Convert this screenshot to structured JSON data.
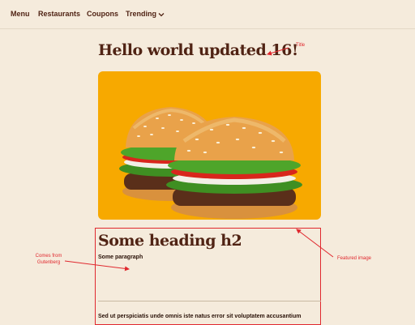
{
  "nav": {
    "items": [
      {
        "label": "Menu"
      },
      {
        "label": "Restaurants"
      },
      {
        "label": "Coupons"
      },
      {
        "label": "Trending"
      }
    ]
  },
  "page": {
    "title": "Hello world updated 16!"
  },
  "content": {
    "heading": "Some heading h2",
    "paragraph": "Some paragraph",
    "lorem": "Sed ut perspiciatis unde omnis iste natus error sit voluptatem accusantium"
  },
  "annotations": {
    "title": "Title",
    "featured_image": "Featured image",
    "gutenberg": "Comes from Gutenberg"
  },
  "colors": {
    "background": "#f5ebdc",
    "text": "#502314",
    "image_bg": "#f7a900",
    "annotation": "#e0282e"
  }
}
